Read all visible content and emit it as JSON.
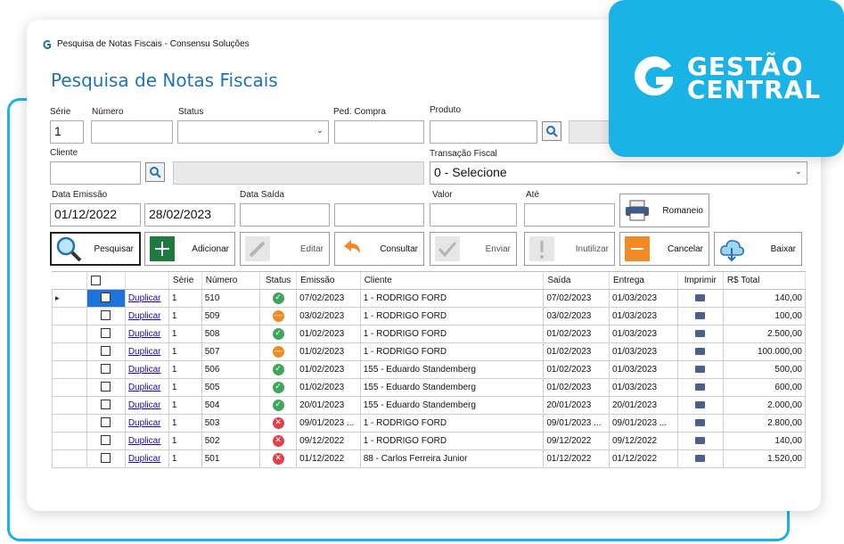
{
  "window": {
    "title": "Pesquisa de Notas Fiscais - Consensu Soluções",
    "heading": "Pesquisa de Notas Fiscais"
  },
  "brand": {
    "line1": "GESTÃO",
    "line2": "CENTRAL",
    "accent": "#1ab3e6"
  },
  "filters": {
    "serie_label": "Série",
    "serie_value": "1",
    "numero_label": "Número",
    "numero_value": "",
    "status_label": "Status",
    "status_value": "",
    "ped_compra_label": "Ped. Compra",
    "ped_compra_value": "",
    "produto_label": "Produto",
    "produto_value": "",
    "produto_desc": "",
    "cliente_label": "Cliente",
    "cliente_value": "",
    "cliente_desc": "",
    "transacao_label": "Transação Fiscal",
    "transacao_value": "0 - Selecione",
    "data_emissao_label": "Data Emissão",
    "data_emissao_de": "01/12/2022",
    "data_emissao_ate": "28/02/2023",
    "data_saida_label": "Data Saída",
    "data_saida_de": "",
    "data_saida_ate": "",
    "valor_label": "Valor",
    "valor_de": "",
    "ate_label": "Até",
    "valor_ate": ""
  },
  "toolbar": {
    "romaneio": "Romaneio",
    "pesquisar": "Pesquisar",
    "adicionar": "Adicionar",
    "editar": "Editar",
    "consultar": "Consultar",
    "enviar": "Enviar",
    "inutilizar": "Inutilizar",
    "cancelar": "Cancelar",
    "baixar": "Baixar"
  },
  "grid": {
    "columns": [
      "",
      "",
      "",
      "Série",
      "Número",
      "Status",
      "Emissão",
      "Cliente",
      "Saída",
      "Entrega",
      "Imprimir",
      "R$ Total"
    ],
    "link_label": "Duplicar",
    "rows": [
      {
        "serie": "1",
        "numero": "510",
        "status": "ok",
        "emissao": "07/02/2023",
        "cliente": "1 - RODRIGO FORD",
        "saida": "07/02/2023",
        "entrega": "01/03/2023",
        "total": "140,00"
      },
      {
        "serie": "1",
        "numero": "509",
        "status": "pend",
        "emissao": "03/02/2023",
        "cliente": "1 - RODRIGO FORD",
        "saida": "03/02/2023",
        "entrega": "01/03/2023",
        "total": "100,00"
      },
      {
        "serie": "1",
        "numero": "508",
        "status": "ok",
        "emissao": "01/02/2023",
        "cliente": "1 - RODRIGO FORD",
        "saida": "01/02/2023",
        "entrega": "01/03/2023",
        "total": "2.500,00"
      },
      {
        "serie": "1",
        "numero": "507",
        "status": "pend",
        "emissao": "01/02/2023",
        "cliente": "1 - RODRIGO FORD",
        "saida": "01/02/2023",
        "entrega": "01/03/2023",
        "total": "100.000,00"
      },
      {
        "serie": "1",
        "numero": "506",
        "status": "ok",
        "emissao": "01/02/2023",
        "cliente": "155 - Eduardo Standemberg",
        "saida": "01/02/2023",
        "entrega": "01/03/2023",
        "total": "500,00"
      },
      {
        "serie": "1",
        "numero": "505",
        "status": "ok",
        "emissao": "01/02/2023",
        "cliente": "155 - Eduardo Standemberg",
        "saida": "01/02/2023",
        "entrega": "01/03/2023",
        "total": "600,00"
      },
      {
        "serie": "1",
        "numero": "504",
        "status": "ok",
        "emissao": "20/01/2023",
        "cliente": "155 - Eduardo Standemberg",
        "saida": "20/01/2023",
        "entrega": "20/01/2023",
        "total": "2.000,00"
      },
      {
        "serie": "1",
        "numero": "503",
        "status": "canc",
        "emissao": "09/01/2023 ...",
        "cliente": "1 - RODRIGO FORD",
        "saida": "09/01/2023 ...",
        "entrega": "09/01/2023 ...",
        "total": "2.800,00"
      },
      {
        "serie": "1",
        "numero": "502",
        "status": "canc",
        "emissao": "09/12/2022",
        "cliente": "1 - RODRIGO FORD",
        "saida": "09/12/2022",
        "entrega": "09/12/2022",
        "total": "140,00"
      },
      {
        "serie": "1",
        "numero": "501",
        "status": "canc",
        "emissao": "01/12/2022",
        "cliente": "88 - Carlos Ferreira Junior",
        "saida": "01/12/2022",
        "entrega": "01/12/2022",
        "total": "1.520,00"
      }
    ]
  },
  "icons": {
    "app": "consensu-logo-icon",
    "search": "magnifier-icon",
    "print": "printer-icon",
    "status_ok": "check-circle-icon",
    "status_pend": "minus-circle-icon",
    "status_canc": "x-circle-icon"
  }
}
